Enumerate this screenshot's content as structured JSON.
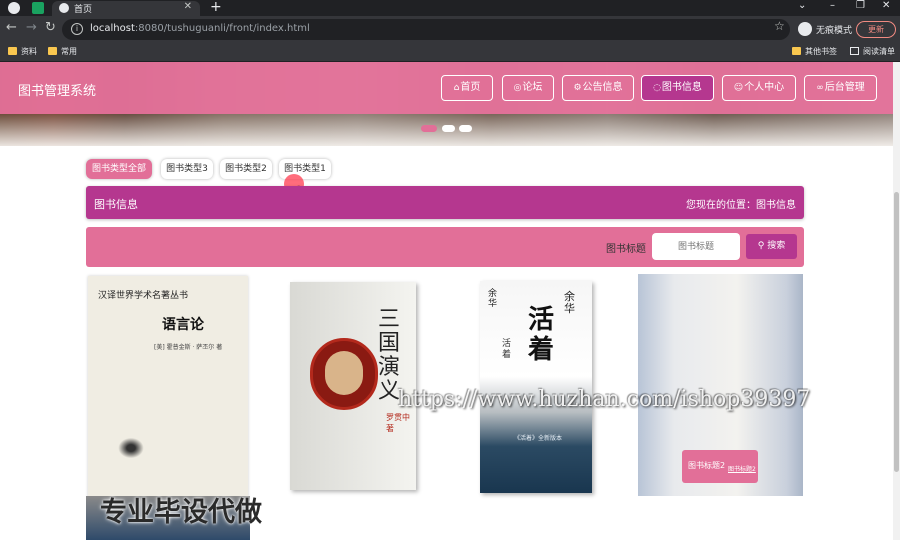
{
  "browser": {
    "tab_title": "首页",
    "new_tab_symbol": "+",
    "url_host": "localhost",
    "url_rest": ":8080/tushuguanli/front/index.html",
    "incognito_label": "无痕模式",
    "update_label": "更新",
    "bookmarks": [
      "资料",
      "常用"
    ],
    "bookmarks_right": [
      "其他书签",
      "阅读清单"
    ]
  },
  "header": {
    "site_title": "图书管理系统",
    "nav": [
      {
        "label": "首页",
        "icon": "home-icon"
      },
      {
        "label": "论坛",
        "icon": "forum-icon"
      },
      {
        "label": "公告信息",
        "icon": "notice-icon"
      },
      {
        "label": "图书信息",
        "icon": "book-icon"
      },
      {
        "label": "个人中心",
        "icon": "user-icon"
      },
      {
        "label": "后台管理",
        "icon": "link-icon"
      }
    ]
  },
  "categories": [
    "图书类型全部",
    "图书类型3",
    "图书类型2",
    "图书类型1"
  ],
  "infobar": {
    "title": "图书信息",
    "location": "您现在的位置：图书信息"
  },
  "search": {
    "label": "图书标题",
    "placeholder": "图书标题",
    "button": "搜索"
  },
  "books": {
    "b1_header": "汉译世界学术名著丛书",
    "b1_title": "语言论",
    "b1_author": "[美] 霍普金斯 · 萨丕尔 著",
    "b2_title": "三国演义",
    "b2_sub": "罗贯中 著",
    "b3_author": "余华",
    "b3_title": "活着",
    "b3_small": "活着",
    "b3_band": "《活着》全新版本",
    "b4_overlay_title": "图书标题2",
    "b4_overlay_link": "图书标题2"
  },
  "watermarks": {
    "url": "https://www.huzhan.com/ishop39397",
    "slogan": "专业毕设代做"
  },
  "colors": {
    "header_pink": "#e26f98",
    "accent_purple": "#b5378f"
  }
}
